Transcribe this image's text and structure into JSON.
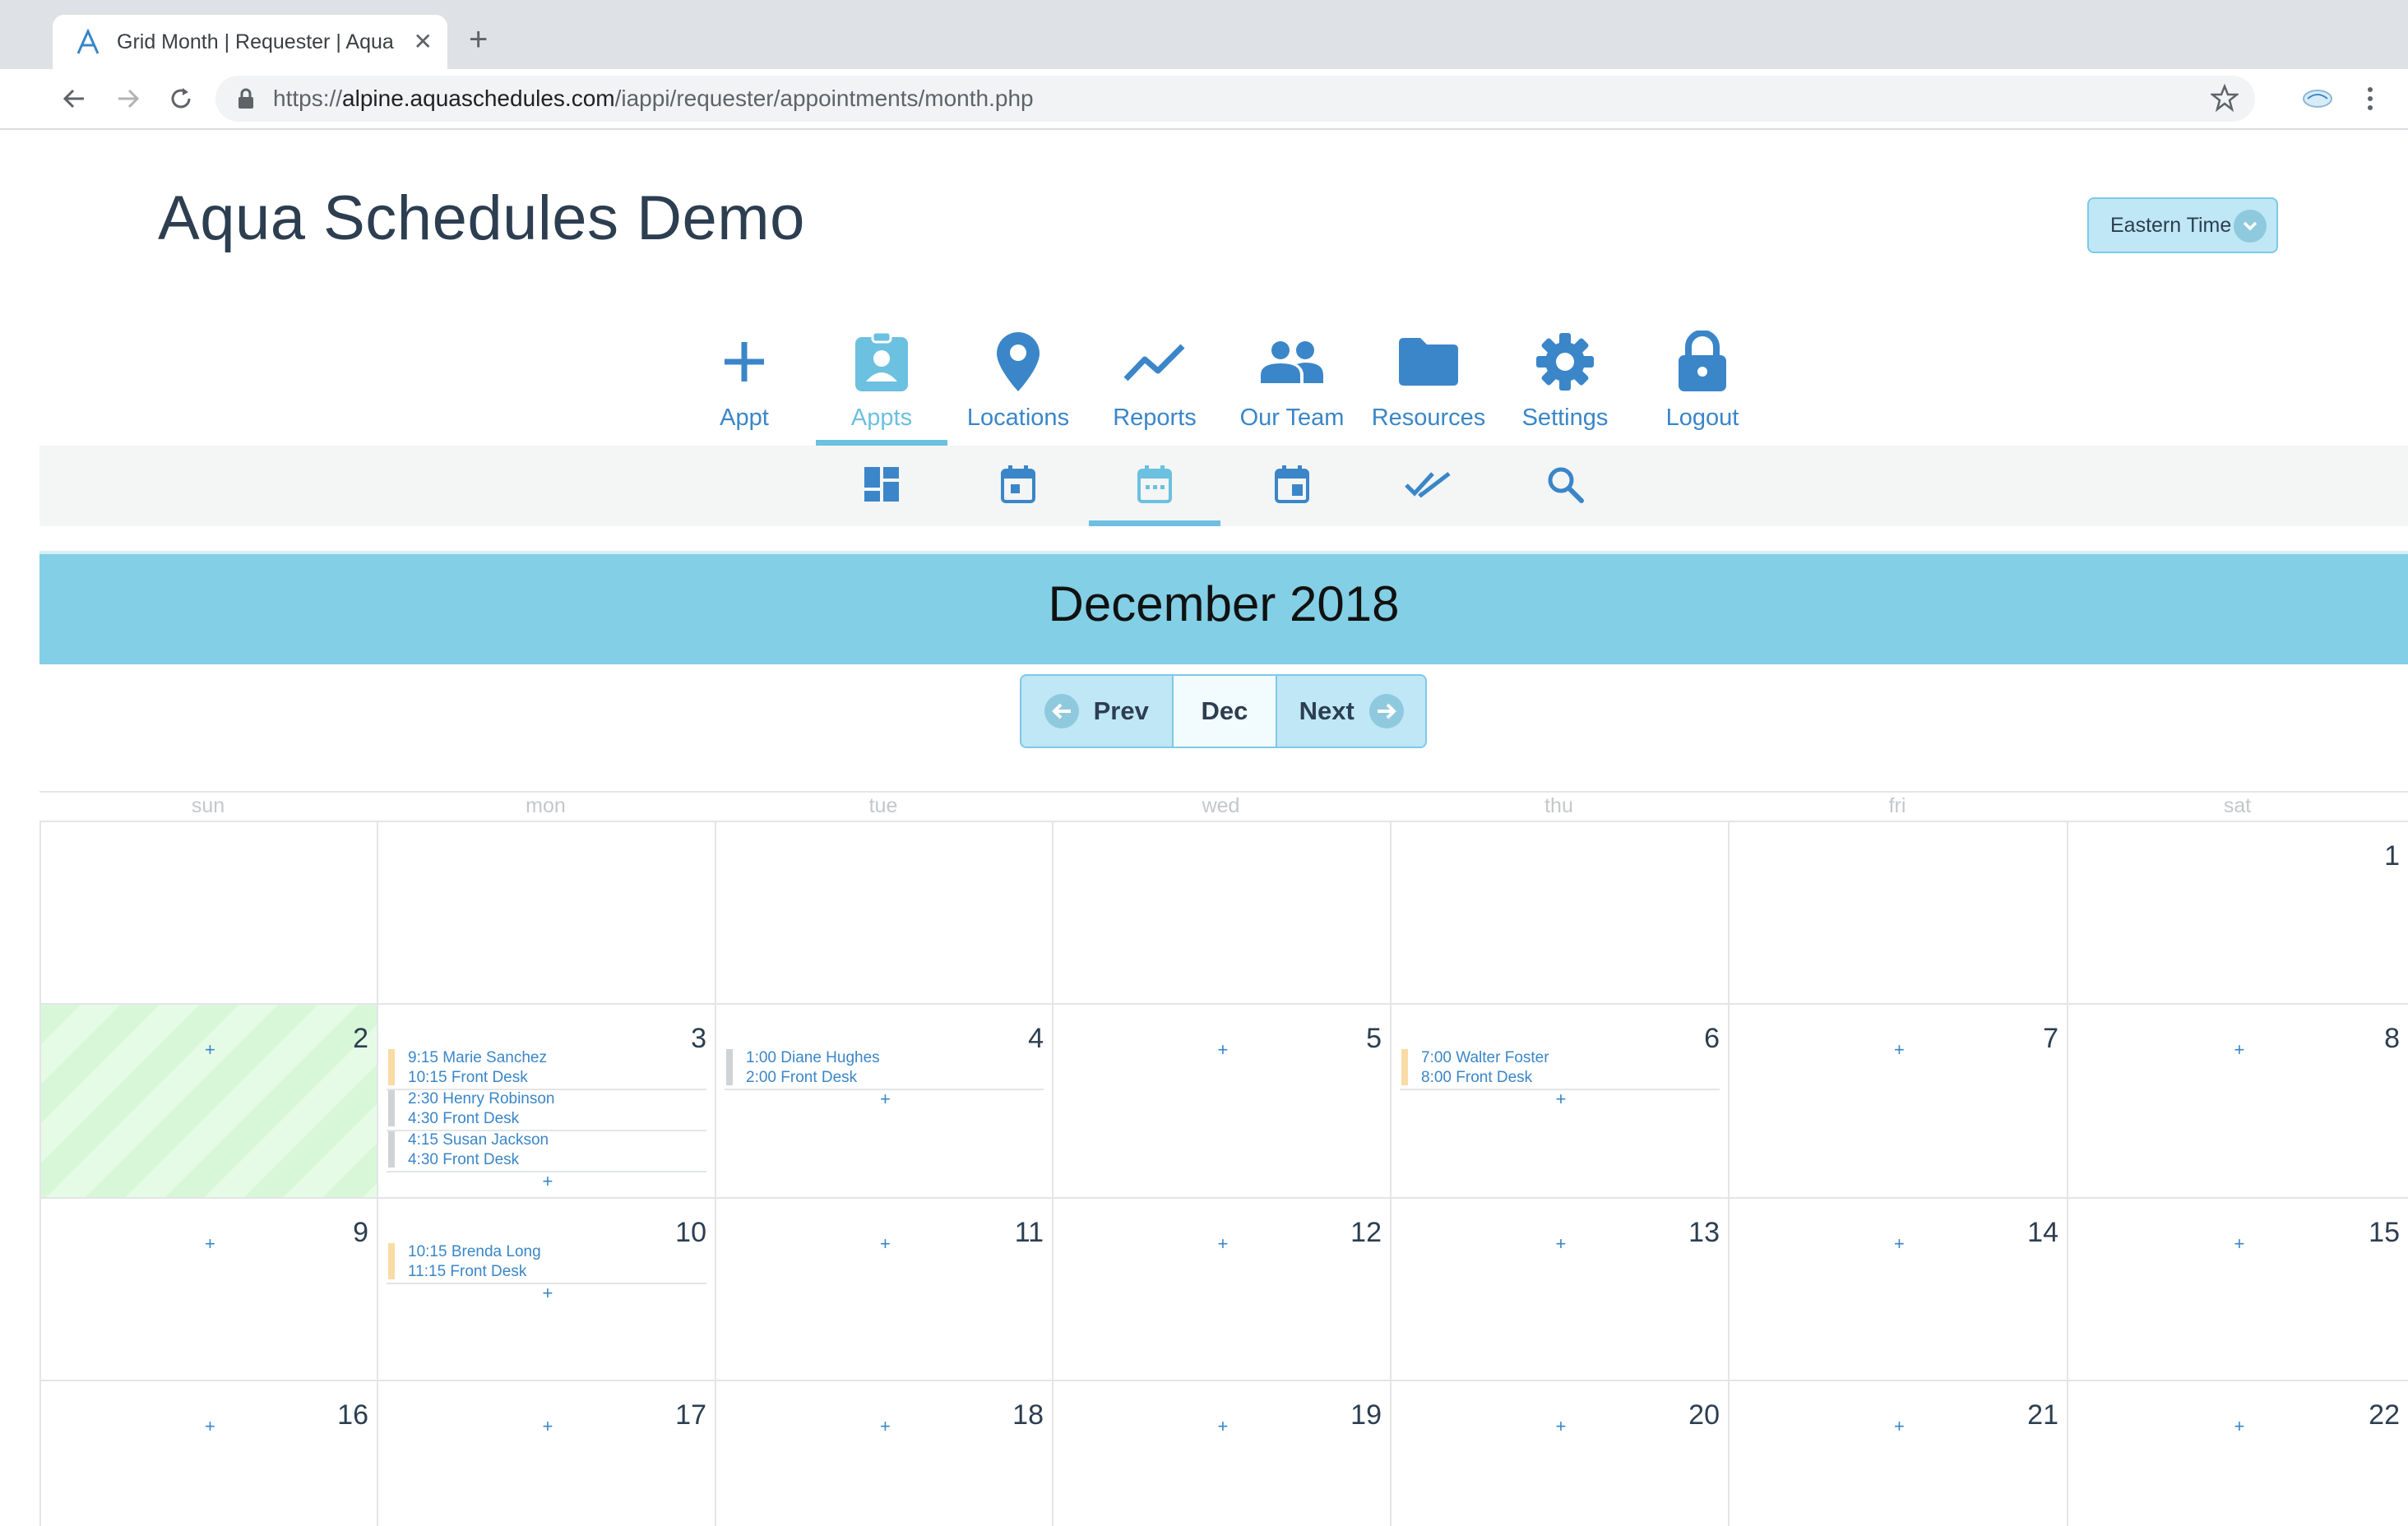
{
  "browser": {
    "tab_title": "Grid Month | Requester | Aqua",
    "url_prefix": "https://",
    "url_host": "alpine.aquaschedules.com",
    "url_path": "/iappi/requester/appointments/month.php"
  },
  "header": {
    "brand": "Aqua Schedules Demo",
    "timezone": "Eastern Time"
  },
  "main_nav": [
    {
      "label": "Appt",
      "icon": "plus-icon",
      "active": false
    },
    {
      "label": "Appts",
      "icon": "clipboard-person-icon",
      "active": true
    },
    {
      "label": "Locations",
      "icon": "map-pin-icon",
      "active": false
    },
    {
      "label": "Reports",
      "icon": "trend-line-icon",
      "active": false
    },
    {
      "label": "Our Team",
      "icon": "people-icon",
      "active": false
    },
    {
      "label": "Resources",
      "icon": "folder-icon",
      "active": false
    },
    {
      "label": "Settings",
      "icon": "gear-icon",
      "active": false
    },
    {
      "label": "Logout",
      "icon": "lock-icon",
      "active": false
    }
  ],
  "sub_nav": [
    {
      "icon": "dashboard-grid-icon",
      "active": false
    },
    {
      "icon": "calendar-day-icon",
      "active": false
    },
    {
      "icon": "calendar-month-icon",
      "active": true
    },
    {
      "icon": "calendar-week-icon",
      "active": false
    },
    {
      "icon": "double-check-icon",
      "active": false
    },
    {
      "icon": "search-icon",
      "active": false
    }
  ],
  "calendar": {
    "month_title": "December 2018",
    "prev_label": "Prev",
    "current_label": "Dec",
    "next_label": "Next",
    "weekdays": [
      "sun",
      "mon",
      "tue",
      "wed",
      "thu",
      "fri",
      "sat"
    ],
    "add_symbol": "+",
    "weeks": [
      [
        {
          "day": ""
        },
        {
          "day": ""
        },
        {
          "day": ""
        },
        {
          "day": ""
        },
        {
          "day": ""
        },
        {
          "day": ""
        },
        {
          "day": "1"
        }
      ],
      [
        {
          "day": "2",
          "today": true
        },
        {
          "day": "3",
          "appointments": [
            {
              "line1": "9:15 Marie Sanchez",
              "line2": "10:15 Front Desk",
              "color": "#f9dba6"
            },
            {
              "line1": "2:30 Henry Robinson",
              "line2": "4:30 Front Desk",
              "color": "#cfd3d6"
            },
            {
              "line1": "4:15 Susan Jackson",
              "line2": "4:30 Front Desk",
              "color": "#cfd3d6"
            }
          ]
        },
        {
          "day": "4",
          "appointments": [
            {
              "line1": "1:00 Diane Hughes",
              "line2": "2:00 Front Desk",
              "color": "#cfd3d6"
            }
          ]
        },
        {
          "day": "5"
        },
        {
          "day": "6",
          "appointments": [
            {
              "line1": "7:00 Walter Foster",
              "line2": "8:00 Front Desk",
              "color": "#f9dba6"
            }
          ]
        },
        {
          "day": "7"
        },
        {
          "day": "8"
        }
      ],
      [
        {
          "day": "9"
        },
        {
          "day": "10",
          "appointments": [
            {
              "line1": "10:15 Brenda Long",
              "line2": "11:15 Front Desk",
              "color": "#f9dba6"
            }
          ]
        },
        {
          "day": "11"
        },
        {
          "day": "12"
        },
        {
          "day": "13"
        },
        {
          "day": "14"
        },
        {
          "day": "15"
        }
      ],
      [
        {
          "day": "16"
        },
        {
          "day": "17"
        },
        {
          "day": "18"
        },
        {
          "day": "19"
        },
        {
          "day": "20"
        },
        {
          "day": "21"
        },
        {
          "day": "22"
        }
      ]
    ]
  },
  "colors": {
    "brand_blue": "#3a86c8",
    "active_light_blue": "#6cc0e0",
    "band": "#83cfe5",
    "today_green": "#d8f7d8"
  }
}
